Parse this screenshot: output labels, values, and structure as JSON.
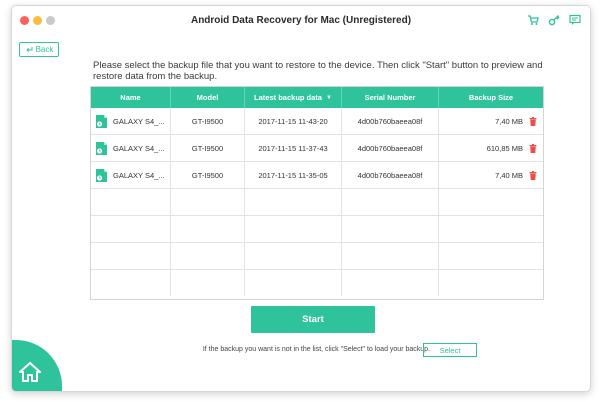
{
  "window": {
    "title": "Android Data Recovery for Mac (Unregistered)"
  },
  "toolbar": {
    "icons": [
      "cart-icon",
      "key-icon",
      "chat-icon"
    ]
  },
  "back": {
    "label": "Back"
  },
  "instructions": "Please select the backup file that you want to restore to the device. Then click \"Start\" button to preview and restore data from the backup.",
  "table": {
    "columns": [
      "Name",
      "Model",
      "Latest backup data",
      "Serial Number",
      "Backup Size"
    ],
    "sorted_column": "Latest backup data",
    "rows": [
      {
        "name": "GALAXY S4_...",
        "model": "GT-I9500",
        "date": "2017-11-15 11-43-20",
        "serial": "4d00b760baeea08f",
        "size": "7,40 MB"
      },
      {
        "name": "GALAXY S4_...",
        "model": "GT-I9500",
        "date": "2017-11-15 11-37-43",
        "serial": "4d00b760baeea08f",
        "size": "610,85 MB"
      },
      {
        "name": "GALAXY S4_...",
        "model": "GT-I9500",
        "date": "2017-11-15 11-35-05",
        "serial": "4d00b760baeea08f",
        "size": "7,40 MB"
      }
    ]
  },
  "start": {
    "label": "Start"
  },
  "footer": {
    "hint": "If the backup you want is not in the list, click \"Select\" to load your backup.",
    "select_label": "Select"
  },
  "colors": {
    "accent": "#2fc39b",
    "delete": "#e8514a"
  }
}
